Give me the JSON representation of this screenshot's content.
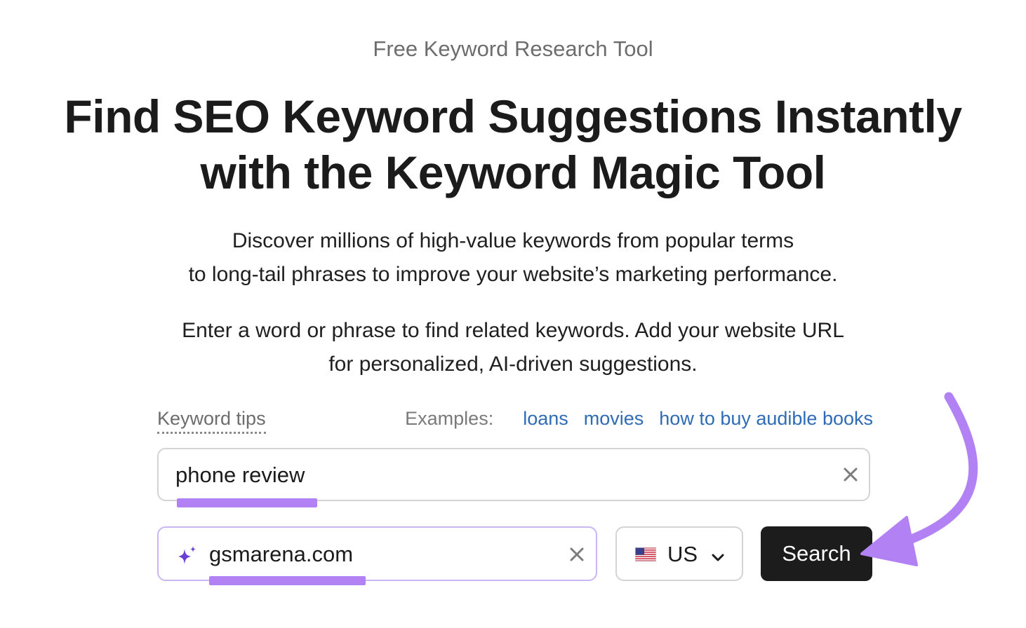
{
  "eyebrow": "Free Keyword Research Tool",
  "headline": {
    "line1": "Find SEO Keyword Suggestions Instantly",
    "line2": "with the Keyword Magic Tool"
  },
  "description": {
    "line1": "Discover millions of high-value keywords from popular terms",
    "line2": "to long-tail phrases to improve your website’s marketing performance."
  },
  "instructions": {
    "line1": "Enter a word or phrase to find related keywords. Add your website URL",
    "line2": "for personalized, AI-driven suggestions."
  },
  "tips": {
    "label": "Keyword tips",
    "examples_label": "Examples:",
    "examples": [
      "loans",
      "movies",
      "how to buy audible books"
    ]
  },
  "keyword_input": {
    "value": "phone review",
    "clear_icon": "close-icon"
  },
  "url_input": {
    "value": "gsmarena.com",
    "leading_icon": "sparkle-icon",
    "clear_icon": "close-icon"
  },
  "country_select": {
    "selected": "US",
    "flag_icon": "us-flag-icon",
    "chevron_icon": "chevron-down-icon"
  },
  "search_button": {
    "label": "Search"
  },
  "colors": {
    "highlight": "#b282f4",
    "url_border": "#c9b6f3",
    "link": "#2f6cb5",
    "button_bg": "#1c1c1c",
    "sparkle": "#6a3fd6"
  }
}
